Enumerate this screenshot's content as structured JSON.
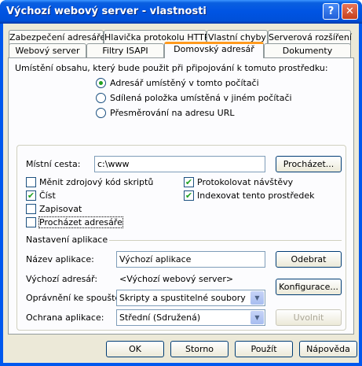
{
  "window": {
    "title": "Výchozí webový server - vlastnosti",
    "help": "?",
    "close": "✕"
  },
  "tabs_row1": [
    "Zabezpečení adresáře",
    "Hlavička protokolu HTTP",
    "Vlastní chyby",
    "Serverová rozšíření"
  ],
  "tabs_row2": [
    "Webový server",
    "Filtry ISAPI",
    "Domovský adresář",
    "Dokumenty"
  ],
  "content_source": {
    "prompt": "Umístění obsahu, který bude použit při připojování k tomuto prostředku:",
    "options": [
      "Adresář umístěný v tomto počítači",
      "Sdílená položka umístěná v jiném počítači",
      "Přesměrování na adresu URL"
    ],
    "selected_index": 0
  },
  "local_path": {
    "label": "Místní cesta:",
    "value": "c:\\www",
    "browse": "Procházet..."
  },
  "checks": {
    "source_access": {
      "label": "Měnit zdrojový kód skriptů",
      "checked": false
    },
    "read": {
      "label": "Číst",
      "checked": true
    },
    "write": {
      "label": "Zapisovat",
      "checked": false
    },
    "browse_dir": {
      "label": "Procházet adresáře",
      "checked": false
    },
    "log_visits": {
      "label": "Protokolovat návštěvy",
      "checked": true
    },
    "index": {
      "label": "Indexovat tento prostředek",
      "checked": true
    }
  },
  "app_settings": {
    "heading": "Nastavení aplikace",
    "name_label": "Název aplikace:",
    "name_value": "Výchozí aplikace",
    "remove": "Odebrat",
    "start_label": "Výchozí adresář:",
    "start_value": "<Výchozí webový server>",
    "config": "Konfigurace...",
    "exec_label": "Oprávnění ke spouštění:",
    "exec_value": "Skripty a spustitelné soubory",
    "protect_label": "Ochrana aplikace:",
    "protect_value": "Střední (Sdružená)",
    "unload": "Uvolnit"
  },
  "footer": {
    "ok": "OK",
    "cancel": "Storno",
    "apply": "Použít",
    "help": "Nápověda"
  },
  "icons": {
    "dropdown": "chevron-down-icon",
    "check": "check-icon"
  },
  "colors": {
    "title_bar": "#0054e3",
    "active_tab_accent": "#ff9a1e",
    "client_bg": "#ece9d8",
    "check_green": "#21a121"
  }
}
